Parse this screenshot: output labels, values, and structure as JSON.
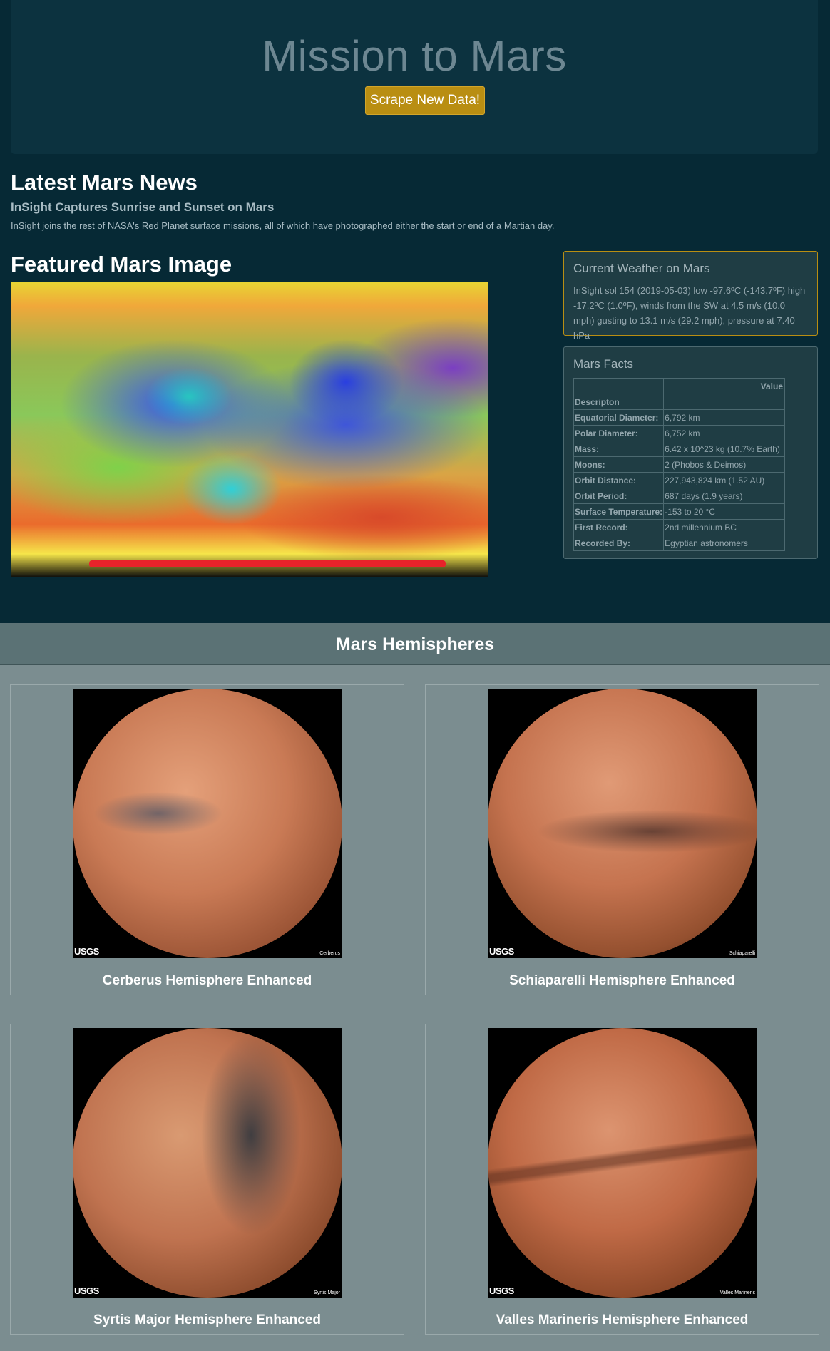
{
  "header": {
    "title": "Mission to Mars",
    "scrape_button": "Scrape New Data!"
  },
  "news": {
    "heading": "Latest Mars News",
    "title": "InSight Captures Sunrise and Sunset on Mars",
    "paragraph": "InSight joins the rest of NASA's Red Planet surface missions, all of which have photographed either the start or end of a Martian day."
  },
  "featured": {
    "heading": "Featured Mars Image"
  },
  "weather": {
    "heading": "Current Weather on Mars",
    "text": "InSight sol 154 (2019-05-03) low -97.6ºC (-143.7ºF) high -17.2ºC (1.0ºF), winds from the SW at 4.5 m/s (10.0 mph) gusting to 13.1 m/s (29.2 mph), pressure at 7.40 hPa"
  },
  "facts": {
    "heading": "Mars Facts",
    "value_header": "Value",
    "rows": [
      {
        "label": "Descripton",
        "value": ""
      },
      {
        "label": "Equatorial Diameter:",
        "value": "6,792 km"
      },
      {
        "label": "Polar Diameter:",
        "value": "6,752 km"
      },
      {
        "label": "Mass:",
        "value": "6.42 x 10^23 kg (10.7% Earth)"
      },
      {
        "label": "Moons:",
        "value": "2 (Phobos & Deimos)"
      },
      {
        "label": "Orbit Distance:",
        "value": "227,943,824 km (1.52 AU)"
      },
      {
        "label": "Orbit Period:",
        "value": "687 days (1.9 years)"
      },
      {
        "label": "Surface Temperature:",
        "value": "-153 to 20 °C"
      },
      {
        "label": "First Record:",
        "value": "2nd millennium BC"
      },
      {
        "label": "Recorded By:",
        "value": "Egyptian astronomers"
      }
    ]
  },
  "hemispheres": {
    "heading": "Mars Hemispheres",
    "logo_text": "USGS",
    "items": [
      {
        "title": "Cerberus Hemisphere Enhanced",
        "image_label": "Cerberus"
      },
      {
        "title": "Schiaparelli Hemisphere Enhanced",
        "image_label": "Schiaparelli"
      },
      {
        "title": "Syrtis Major Hemisphere Enhanced",
        "image_label": "Syrtis Major"
      },
      {
        "title": "Valles Marineris Hemisphere Enhanced",
        "image_label": "Valles Marineris"
      }
    ]
  }
}
